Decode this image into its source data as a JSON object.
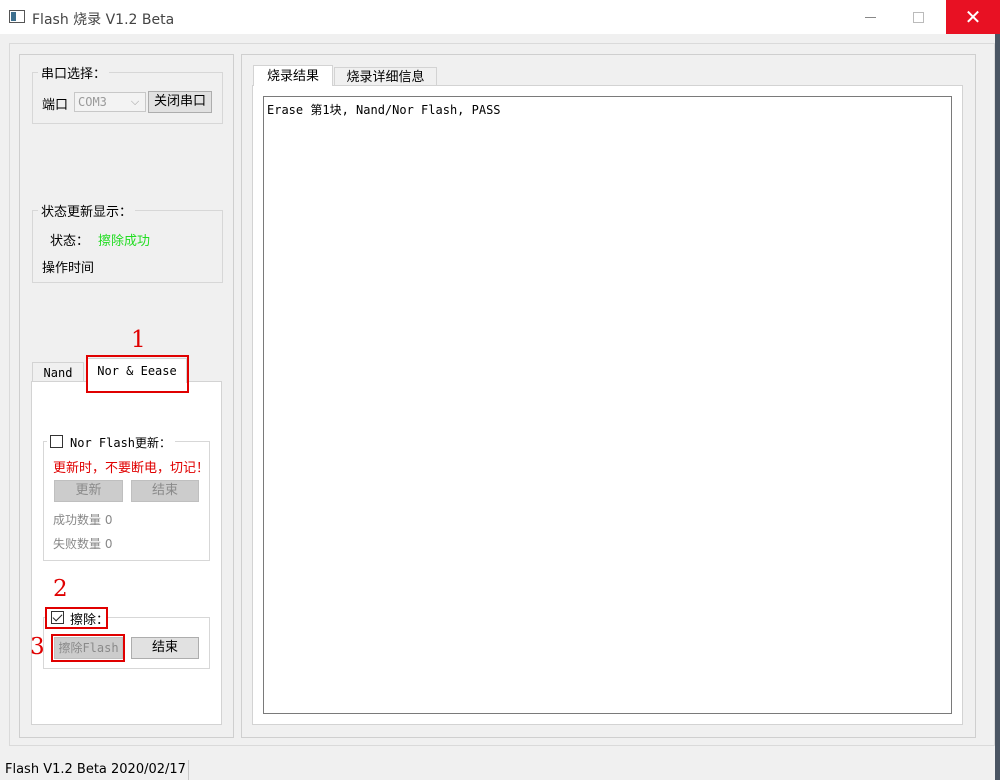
{
  "window": {
    "title": "Flash 烧录  V1.2 Beta",
    "close_glyph": "✕"
  },
  "serial": {
    "group_title": "串口选择：",
    "port_label": "端口",
    "port_value": "COM3",
    "close_port_button": "关闭串口"
  },
  "status": {
    "group_title": "状态更新显示：",
    "label": "状态：",
    "value": "擦除成功",
    "operation_time_label": "操作时间"
  },
  "left_tabs": [
    {
      "label": "Nand"
    },
    {
      "label": "Nor & Eease"
    }
  ],
  "nor": {
    "checkbox_label": "Nor Flash更新：",
    "warning": "更新时，不要断电，切记！",
    "update_button": "更新",
    "end_button": "结束",
    "success_label": "成功数量",
    "success_count": "0",
    "fail_label": "失败数量",
    "fail_count": "0"
  },
  "erase": {
    "checkbox_label": "擦除：",
    "checked": true,
    "erase_button": "擦除Flash",
    "end_button": "结束"
  },
  "right_tabs": [
    {
      "label": "烧录结果"
    },
    {
      "label": "烧录详细信息"
    }
  ],
  "log": {
    "line1": "Erase 第1块, Nand/Nor Flash, PASS"
  },
  "annotations": {
    "a1": "1",
    "a2": "2",
    "a3": "3"
  },
  "statusbar": {
    "text": "Flash  V1.2 Beta  2020/02/17"
  },
  "colors": {
    "status_ok": "#22dd22",
    "warning": "#e00000",
    "annotation": "#e00000",
    "close_button": "#e81123"
  }
}
